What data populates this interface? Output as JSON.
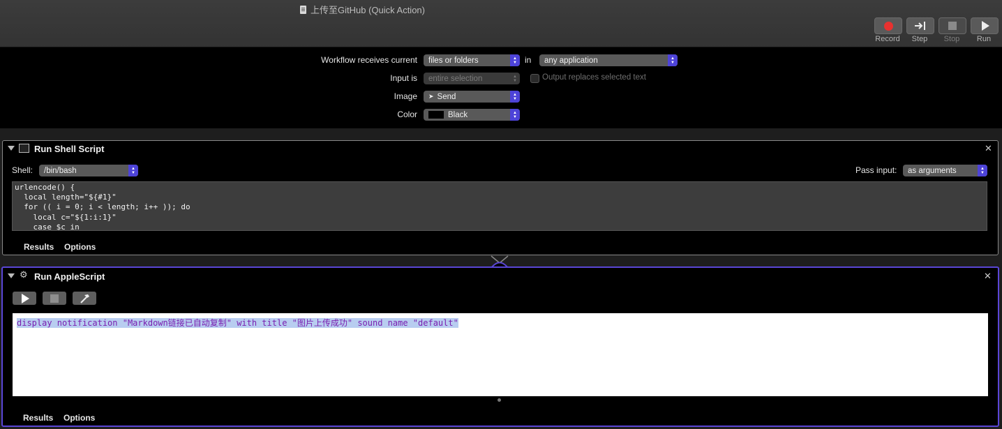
{
  "window": {
    "title": "上传至GitHub (Quick Action)"
  },
  "toolbar": {
    "record_label": "Record",
    "step_label": "Step",
    "stop_label": "Stop",
    "run_label": "Run"
  },
  "workflow": {
    "receives_label": "Workflow receives current",
    "receives_value": "files or folders",
    "in_label": "in",
    "app_value": "any application",
    "input_label": "Input is",
    "input_value": "entire selection",
    "replaces_label": "Output replaces selected text",
    "image_label": "Image",
    "image_value": "Send",
    "color_label": "Color",
    "color_value": "Black"
  },
  "shell_action": {
    "title": "Run Shell Script",
    "shell_label": "Shell:",
    "shell_value": "/bin/bash",
    "pass_label": "Pass input:",
    "pass_value": "as arguments",
    "code_lines": [
      "urlencode() {",
      "  local length=\"${#1}\"",
      "  for (( i = 0; i < length; i++ )); do",
      "    local c=\"${1:i:1}\"",
      "    case $c in"
    ],
    "tab_results": "Results",
    "tab_options": "Options"
  },
  "applescript_action": {
    "title": "Run AppleScript",
    "script_text": "display notification \"Markdown链接已自动复制\" with title \"图片上传成功\" sound name \"default\"",
    "tab_results": "Results",
    "tab_options": "Options"
  },
  "colors": {
    "accent": "#5a46d6",
    "record": "#e8312f",
    "script_text": "#7a1fb0"
  }
}
